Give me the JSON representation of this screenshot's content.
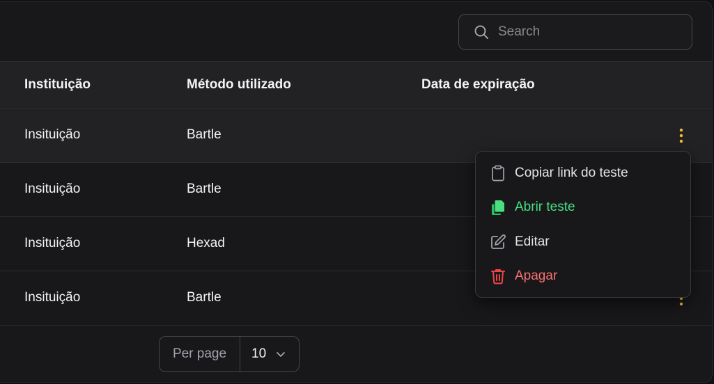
{
  "search": {
    "placeholder": "Search",
    "value": ""
  },
  "table": {
    "columns": [
      "Instituição",
      "Método utilizado",
      "Data de expiração"
    ],
    "rows": [
      {
        "institution": "Insituição",
        "method": "Bartle",
        "expiration": ""
      },
      {
        "institution": "Insituição",
        "method": "Bartle",
        "expiration": ""
      },
      {
        "institution": "Insituição",
        "method": "Hexad",
        "expiration": ""
      },
      {
        "institution": "Insituição",
        "method": "Bartle",
        "expiration": ""
      }
    ]
  },
  "menu": {
    "items": [
      {
        "label": "Copiar link do teste",
        "icon": "clipboard-icon",
        "color": "#e4e4e7"
      },
      {
        "label": "Abrir teste",
        "icon": "documents-icon",
        "color": "#4ade80"
      },
      {
        "label": "Editar",
        "icon": "pencil-square-icon",
        "color": "#e4e4e7"
      },
      {
        "label": "Apagar",
        "icon": "trash-icon",
        "color": "#f87171"
      }
    ]
  },
  "pagination": {
    "per_page_label": "Per page",
    "per_page_value": "10"
  },
  "colors": {
    "accent_kebab": "#f5b93a",
    "success": "#4ade80",
    "danger": "#f87171",
    "background": "#18181b"
  }
}
